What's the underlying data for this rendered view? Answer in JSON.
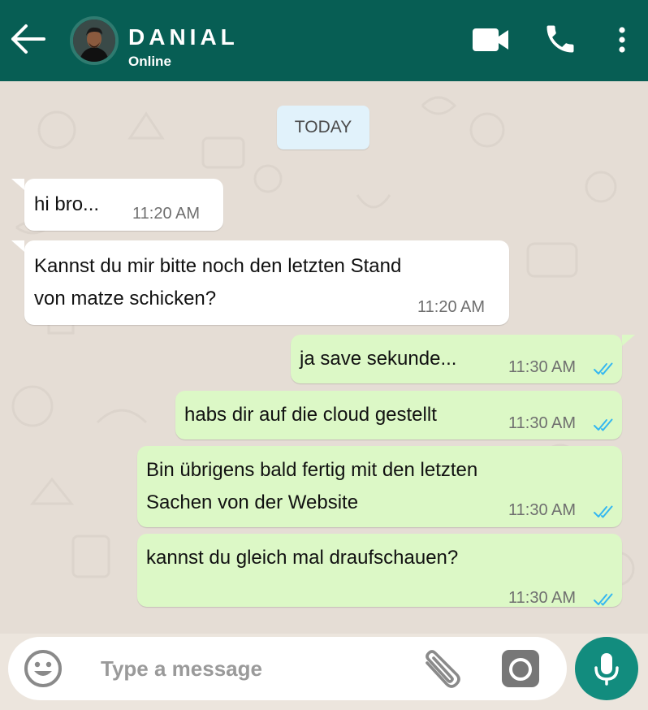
{
  "header": {
    "contact_name": "DANIAL",
    "status": "Online"
  },
  "date_divider": "TODAY",
  "messages": [
    {
      "direction": "in",
      "lines": [
        "hi bro..."
      ],
      "time": "11:20 AM"
    },
    {
      "direction": "in",
      "lines": [
        "Kannst du mir bitte noch den letzten Stand",
        "von matze schicken?"
      ],
      "time": "11:20 AM"
    },
    {
      "direction": "out",
      "lines": [
        "ja save sekunde..."
      ],
      "time": "11:30 AM",
      "read": true
    },
    {
      "direction": "out",
      "lines": [
        "habs dir auf die cloud gestellt"
      ],
      "time": "11:30 AM",
      "read": true
    },
    {
      "direction": "out",
      "lines": [
        "Bin übrigens bald fertig mit den letzten",
        "Sachen von der Website"
      ],
      "time": "11:30 AM",
      "read": true
    },
    {
      "direction": "out",
      "lines": [
        "kannst du gleich mal draufschauen?"
      ],
      "time": "11:30 AM",
      "read": true
    }
  ],
  "input": {
    "placeholder": "Type a message"
  },
  "icons": {
    "back": "arrow-left-icon",
    "video": "video-camera-icon",
    "call": "phone-icon",
    "menu": "more-vertical-icon",
    "emoji": "emoji-icon",
    "attach": "paperclip-icon",
    "camera": "camera-icon",
    "mic": "microphone-icon",
    "read_receipt": "double-check-icon"
  },
  "colors": {
    "header": "#075e54",
    "incoming_bubble": "#ffffff",
    "outgoing_bubble": "#dcf8c6",
    "chat_background": "#e5ddd5",
    "date_chip": "#e1f2fb",
    "mic_button": "#128c7e",
    "read_ticks": "#34b7f1"
  }
}
